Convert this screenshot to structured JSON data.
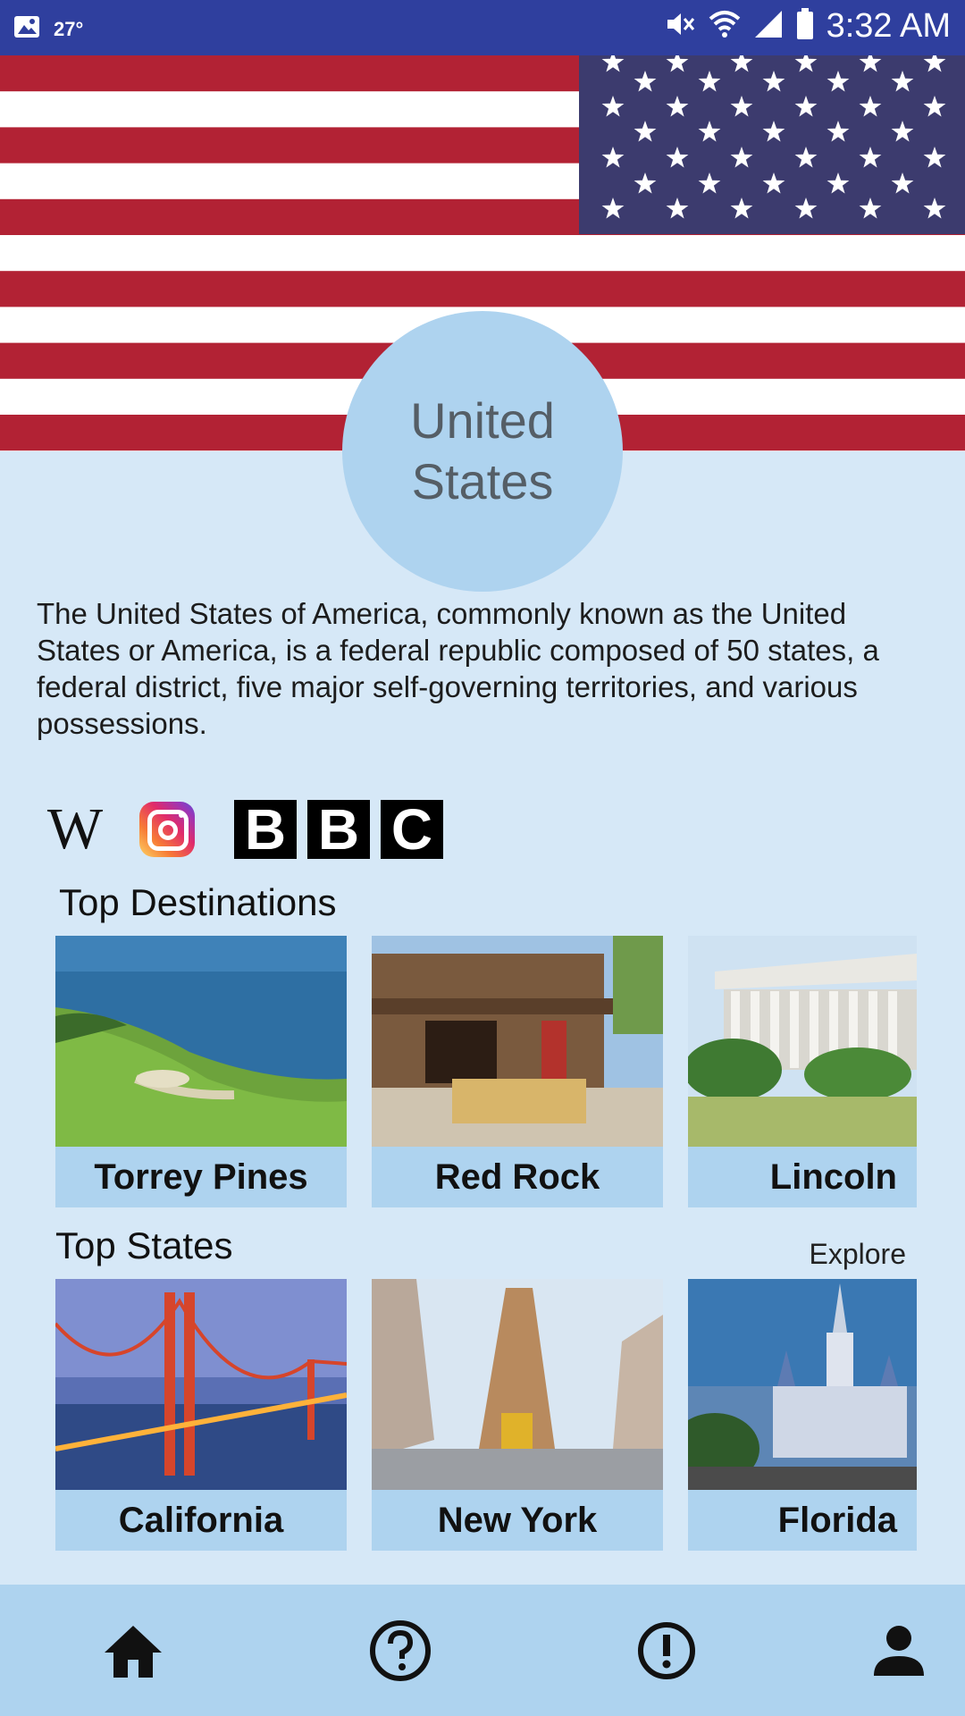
{
  "status_bar": {
    "temperature": "27°",
    "time": "3:32 AM"
  },
  "country": {
    "name": "United States"
  },
  "description": "The United States of America, commonly known as the United States or America, is a federal republic composed of 50 states, a federal district, five major self-governing territories, and various possessions.",
  "sources": {
    "wikipedia_letter": "W",
    "bbc_letters": [
      "B",
      "B",
      "C"
    ]
  },
  "top_destinations": {
    "title": "Top Destinations",
    "items": [
      {
        "label": "Torrey Pines"
      },
      {
        "label": "Red Rock"
      },
      {
        "label": "Lincoln"
      }
    ]
  },
  "top_states": {
    "title": "Top States",
    "explore_label": "Explore",
    "items": [
      {
        "label": "California"
      },
      {
        "label": "New York"
      },
      {
        "label": "Florida"
      }
    ]
  },
  "nav": {
    "items": [
      "home-icon",
      "help-icon",
      "alert-icon",
      "profile-icon"
    ]
  },
  "colors": {
    "status_bar": "#2f3f9e",
    "background": "#d6e8f7",
    "accent": "#aed3ef",
    "flag_red": "#b22234",
    "flag_blue": "#3c3b6e"
  }
}
